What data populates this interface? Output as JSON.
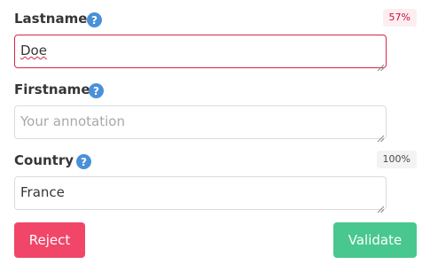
{
  "fields": [
    {
      "label": "Lastname",
      "value": "Doe",
      "placeholder": "",
      "badge": "57%"
    },
    {
      "label": "Firstname",
      "value": "",
      "placeholder": "Your annotation",
      "badge": ""
    },
    {
      "label": "Country",
      "value": "France",
      "placeholder": "",
      "badge": "100%"
    }
  ],
  "buttons": {
    "reject": "Reject",
    "validate": "Validate"
  },
  "colors": {
    "help_icon": "#4a90d9",
    "error_border": "#d9254a",
    "reject": "#f14668",
    "validate": "#48c78e",
    "warn_badge_bg": "#fdeef1",
    "warn_badge_text": "#cc0f35",
    "ok_badge_bg": "#f3f3f3"
  },
  "icons": {
    "help": "question-circle-icon",
    "resize": "resize-grip-icon"
  }
}
